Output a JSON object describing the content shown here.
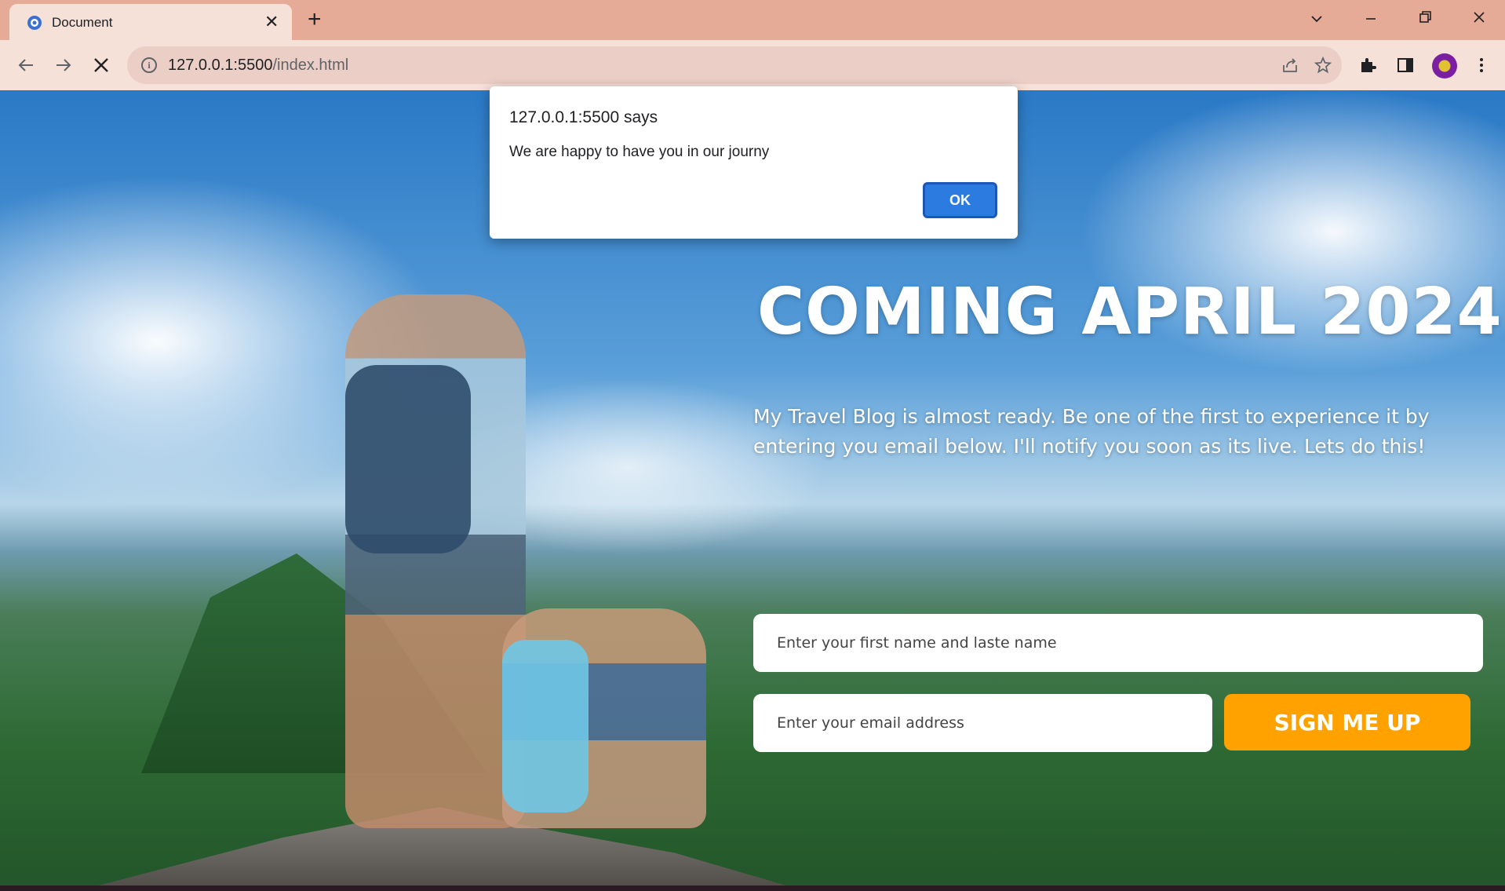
{
  "browser": {
    "tab_title": "Document",
    "tab_close_glyph": "✕",
    "new_tab_glyph": "+",
    "url_host": "127.0.0.1:5500",
    "url_path": "/index.html",
    "icons": [
      "back-arrow-icon",
      "forward-arrow-icon",
      "stop-loading-icon",
      "site-info-icon",
      "share-icon",
      "bookmark-star-icon",
      "extensions-puzzle-icon",
      "side-panel-icon",
      "profile-avatar-icon",
      "menu-kebab-icon",
      "chevron-down-icon",
      "minimize-icon",
      "restore-icon",
      "close-icon"
    ]
  },
  "alert": {
    "title": "127.0.0.1:5500 says",
    "message": "We are happy to have you in our journy",
    "ok_label": "OK"
  },
  "hero": {
    "headline": "COMING APRIL 2024",
    "subtext": "My Travel Blog is almost ready. Be one of the first to experience it by entering you email below. I'll notify you soon as its live. Lets do this!"
  },
  "form": {
    "name_placeholder": "Enter your first name and laste name",
    "email_placeholder": "Enter your email address",
    "submit_label": "SIGN ME UP"
  },
  "colors": {
    "tabbar": "#e6ab96",
    "toolbar": "#f6e1d9",
    "button_accent": "#ffa200",
    "ok_button": "#2c7be0"
  }
}
